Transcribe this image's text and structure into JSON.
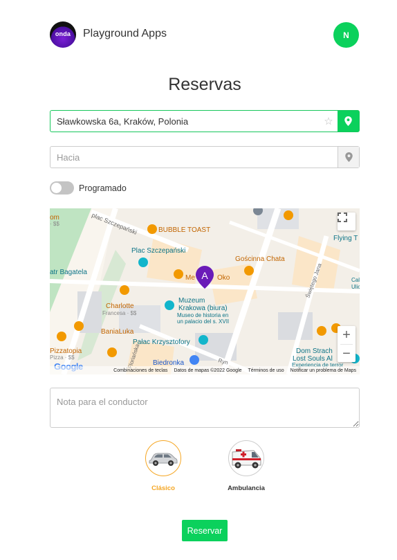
{
  "header": {
    "logo_text": "onda",
    "app_name": "Playground Apps",
    "avatar_initial": "N"
  },
  "page_title": "Reservas",
  "origin": {
    "value": "Sławkowska 6a, Kraków, Polonia",
    "icon": "star-icon",
    "action_icon": "map-pin-icon"
  },
  "destination": {
    "placeholder": "Hacia",
    "action_icon": "map-pin-icon"
  },
  "scheduled": {
    "label": "Programado",
    "enabled": false
  },
  "map": {
    "marker": "A",
    "places": {
      "bubble_toast": "BUBBLE TOAST",
      "plac_szczepanski": "Plac Szczepański",
      "goscinna_chata": "Gościnna Chata",
      "me_oko": "Me",
      "oko": "Oko",
      "charlotte": "Charlotte",
      "charlotte_sub": "Francesa · $$",
      "museum": "Muzeum",
      "museum2": "Krakowa (biura)",
      "museum_sub1": "Museo de historia en",
      "museum_sub2": "un palacio del s. XVII",
      "palac": "Pałac Krzysztofory",
      "bania": "BaniaLuka",
      "pizzatopia": "Pizzatopia",
      "pizzatopia_sub": "Pizza · $$",
      "biedronka": "Biedronka",
      "dom1": "Dom Strach",
      "dom2": "Lost Souls Al",
      "dom3": "Experiencia de terror",
      "flying": "Flying T",
      "bagatela": "atr Bagatela",
      "om": "om",
      "om_sub": "· $$",
      "cal": "Cal",
      "cal2": "Ulic",
      "street_plac": "plac Szczepański",
      "street_swietego": "Świętego Jana",
      "street_florian": "Floriańska",
      "street_ryn": "Ryn"
    },
    "footer": {
      "shortcuts": "Combinaciones de teclas",
      "data": "Datos de mapas ©2022 Google",
      "terms": "Términos de uso",
      "report": "Notificar un problema de Maps"
    },
    "brand": "Google"
  },
  "note": {
    "placeholder": "Nota para el conductor"
  },
  "vehicles": [
    {
      "label": "Clásico",
      "icon": "car-icon",
      "selected": true,
      "color": "#f5a623"
    },
    {
      "label": "Ambulancia",
      "icon": "ambulance-icon",
      "selected": false,
      "color": "#333333"
    }
  ],
  "submit_label": "Reservar",
  "colors": {
    "accent": "#0bd15c",
    "selected": "#f5a623",
    "marker": "#6a1bb8"
  }
}
